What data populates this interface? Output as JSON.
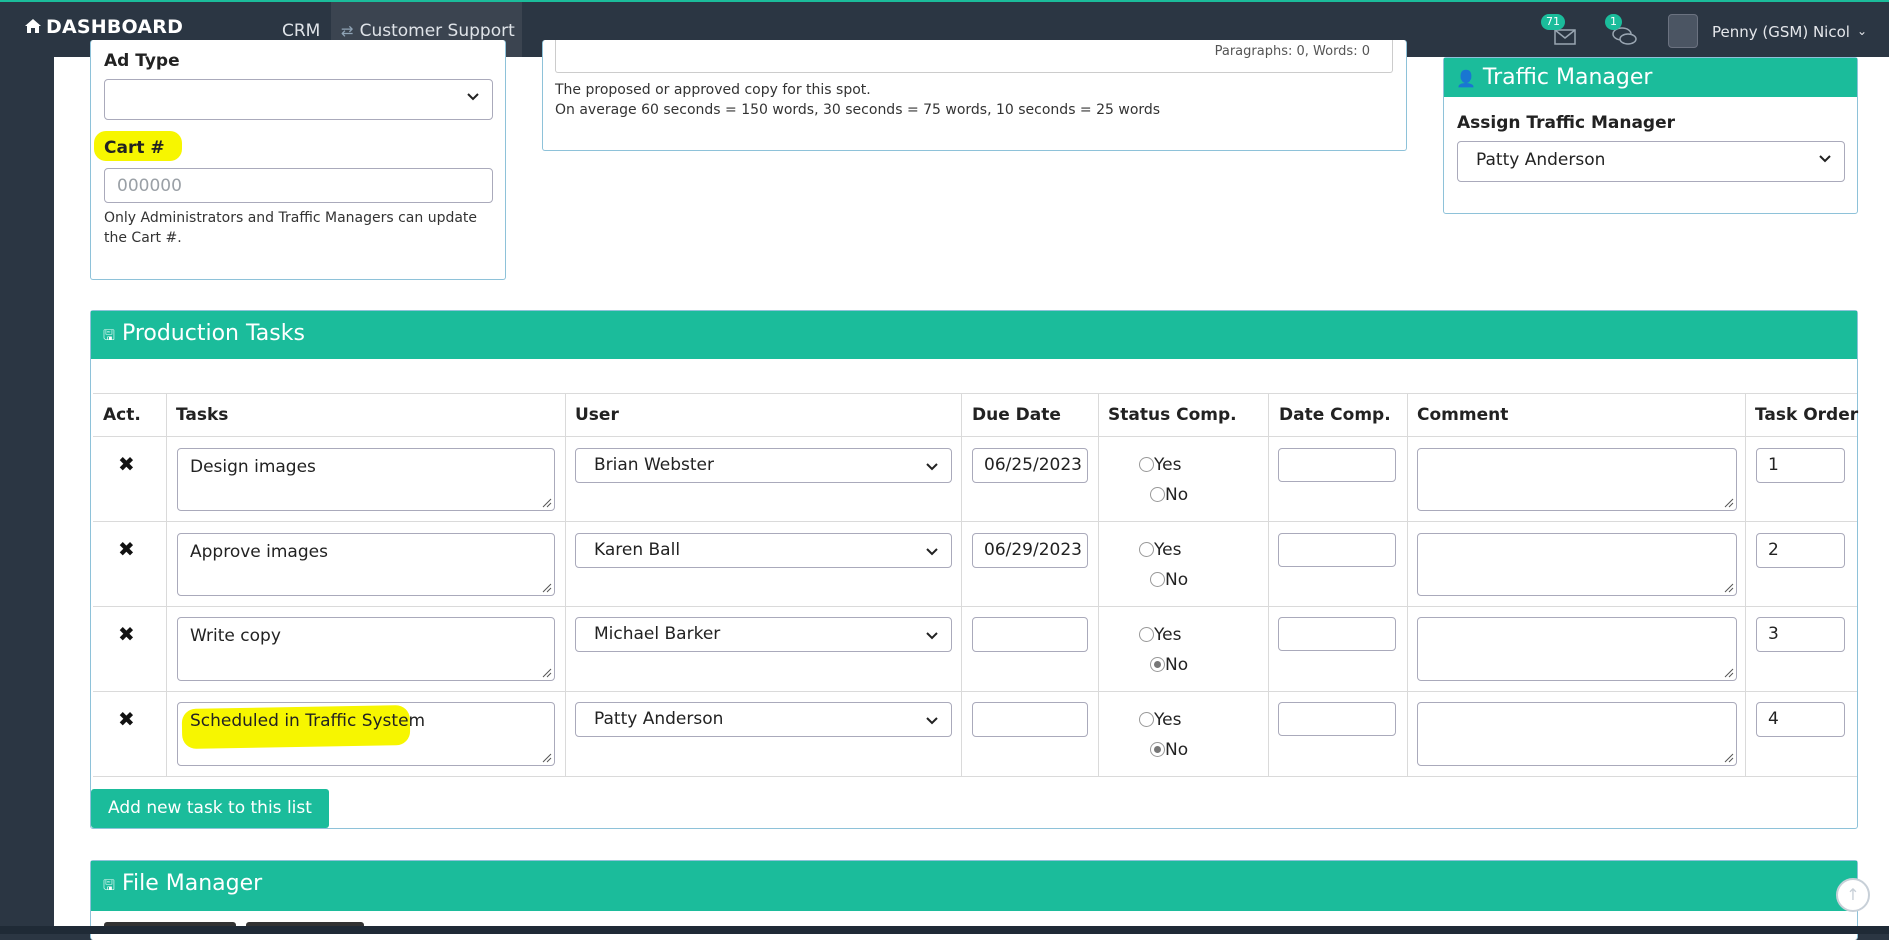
{
  "nav": {
    "brand": "DASHBOARD",
    "crm": "CRM",
    "support": "Customer Support",
    "messages_count": "71",
    "chat_count": "1",
    "user_name": "Penny (GSM) Nicol"
  },
  "ad_card": {
    "ad_type_label": "Ad Type",
    "ad_type_value": "",
    "cart_label": "Cart #",
    "cart_placeholder": "000000",
    "cart_note": "Only Administrators and Traffic Managers can update the Cart #."
  },
  "copy_card": {
    "counter": "Paragraphs: 0, Words: 0",
    "help_1": "The proposed or approved copy for this spot.",
    "help_2": "On average 60 seconds = 150 words, 30 seconds = 75 words, 10 seconds = 25 words"
  },
  "traffic_card": {
    "title": "Traffic Manager",
    "assign_label": "Assign Traffic Manager",
    "assign_value": "Patty Anderson"
  },
  "production": {
    "title": "Production Tasks",
    "headers": [
      "Act.",
      "Tasks",
      "User",
      "Due Date",
      "Status Comp.",
      "Date Comp.",
      "Comment",
      "Task Order"
    ],
    "yes_label": "Yes",
    "no_label": "No",
    "rows": [
      {
        "task": "Design images",
        "user": "Brian Webster",
        "due": "06/25/2023",
        "status": "",
        "date_comp": "",
        "comment": "",
        "order": "1"
      },
      {
        "task": "Approve images",
        "user": "Karen Ball",
        "due": "06/29/2023",
        "status": "",
        "date_comp": "",
        "comment": "",
        "order": "2"
      },
      {
        "task": "Write copy",
        "user": "Michael Barker",
        "due": "",
        "status": "No",
        "date_comp": "",
        "comment": "",
        "order": "3"
      },
      {
        "task": "Scheduled in Traffic System",
        "user": "Patty Anderson",
        "due": "",
        "status": "No",
        "date_comp": "",
        "comment": "",
        "order": "4"
      }
    ],
    "add_button": "Add new task to this list"
  },
  "file_manager": {
    "title": "File Manager"
  },
  "colors": {
    "accent": "#1bbc9b",
    "navbar": "#2b3643",
    "highlight": "#f7f600"
  }
}
